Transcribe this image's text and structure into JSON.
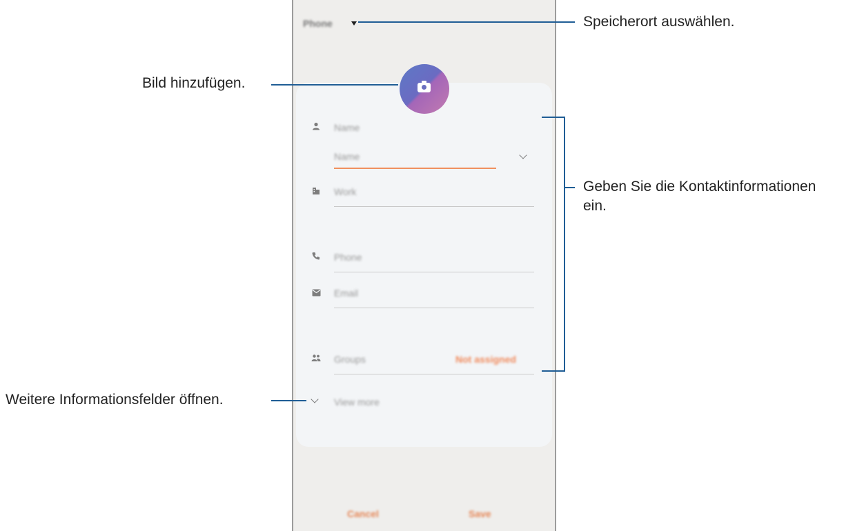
{
  "screen": {
    "storage_label": "Phone",
    "fields": {
      "name_label": "Name",
      "name_value": "Name",
      "work_label": "Work",
      "phone_label": "Phone",
      "email_label": "Email",
      "groups_label": "Groups",
      "groups_value": "Not assigned",
      "view_more": "View more"
    },
    "footer": {
      "cancel": "Cancel",
      "save": "Save"
    },
    "accent_color": "#f08a5c"
  },
  "callouts": {
    "storage": "Speicherort auswählen.",
    "image": "Bild hinzufügen.",
    "contact_info_1": "Geben Sie die Kontaktinformationen",
    "contact_info_2": "ein.",
    "more_fields": "Weitere Informationsfelder öffnen."
  }
}
